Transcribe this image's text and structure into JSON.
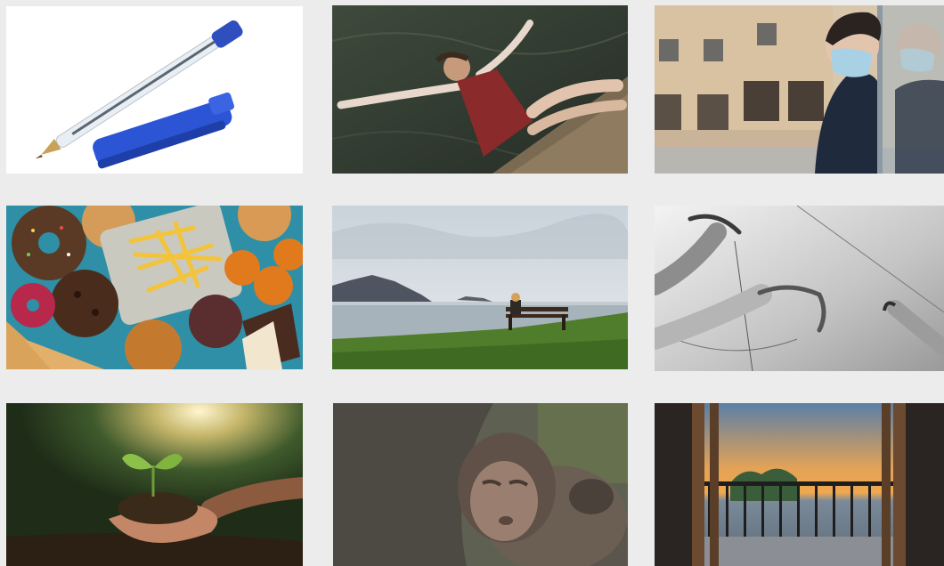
{
  "gallery": {
    "tiles": [
      {
        "subject": "pen-photo"
      },
      {
        "subject": "floating-woman-photo"
      },
      {
        "subject": "masked-child-window-photo"
      },
      {
        "subject": "junk-food-photo"
      },
      {
        "subject": "coastal-bench-photo"
      },
      {
        "subject": "reaching-hands-photo"
      },
      {
        "subject": "seedling-hands-photo"
      },
      {
        "subject": "baby-monkey-photo"
      },
      {
        "subject": "sunset-balcony-photo"
      }
    ]
  }
}
